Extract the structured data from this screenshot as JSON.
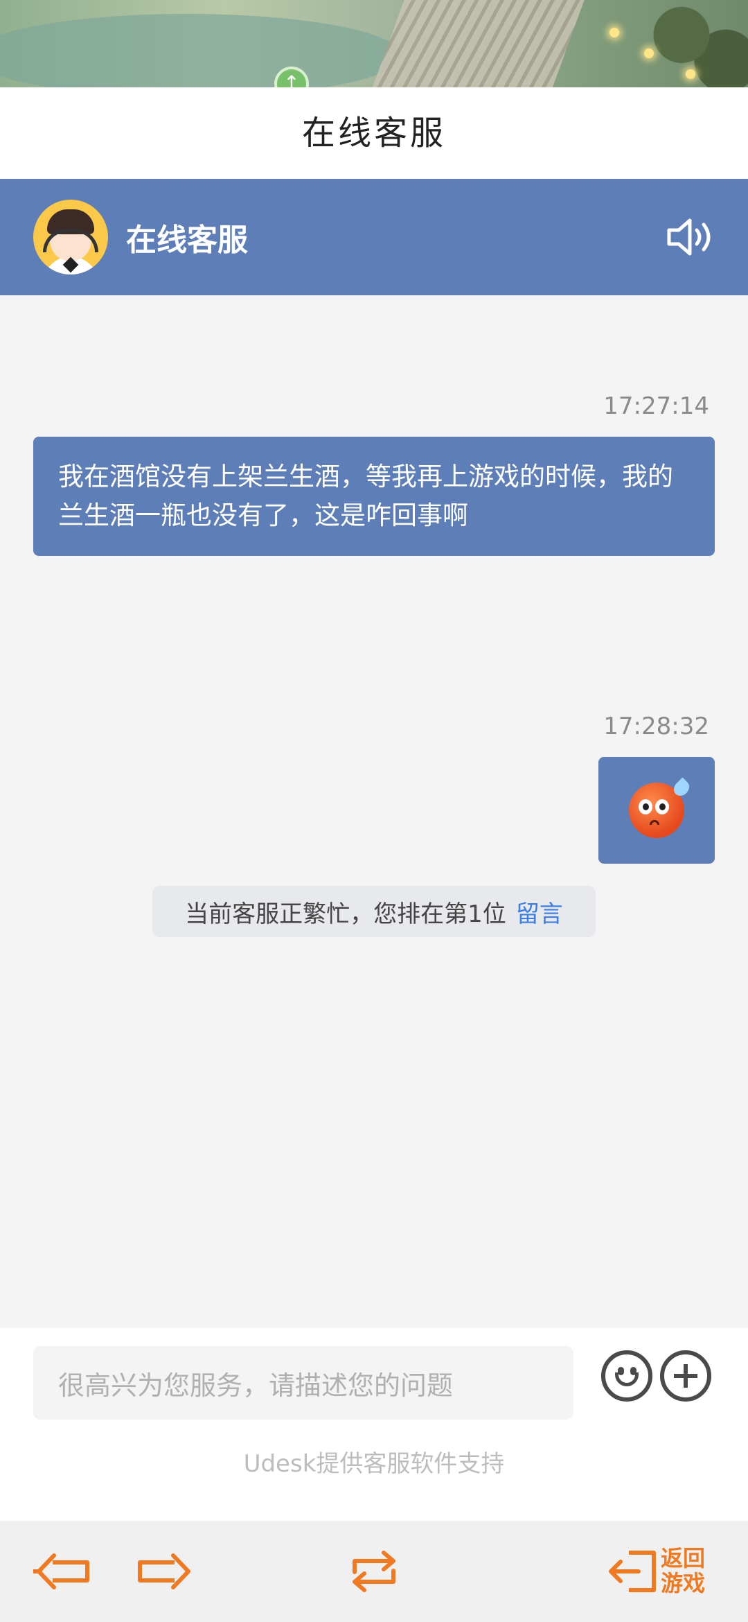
{
  "page": {
    "title": "在线客服"
  },
  "chat_header": {
    "agent_name": "在线客服"
  },
  "messages": [
    {
      "time": "17:27:14",
      "text": "我在酒馆没有上架兰生酒，等我再上游戏的时候，我的兰生酒一瓶也没有了，这是咋回事啊"
    },
    {
      "time": "17:28:32",
      "emoji": "sweat-face-emoji"
    }
  ],
  "notice": {
    "text": "当前客服正繁忙，您排在第1位",
    "link": "留言"
  },
  "input": {
    "placeholder": "很高兴为您服务，请描述您的问题"
  },
  "powered_by": "Udesk提供客服软件支持",
  "bottom_bar": {
    "back_game": "返回游戏"
  },
  "colors": {
    "header": "#5e7eb8",
    "bubble": "#5e7eb8",
    "accent": "#f07a22",
    "link": "#3b7ee6"
  }
}
